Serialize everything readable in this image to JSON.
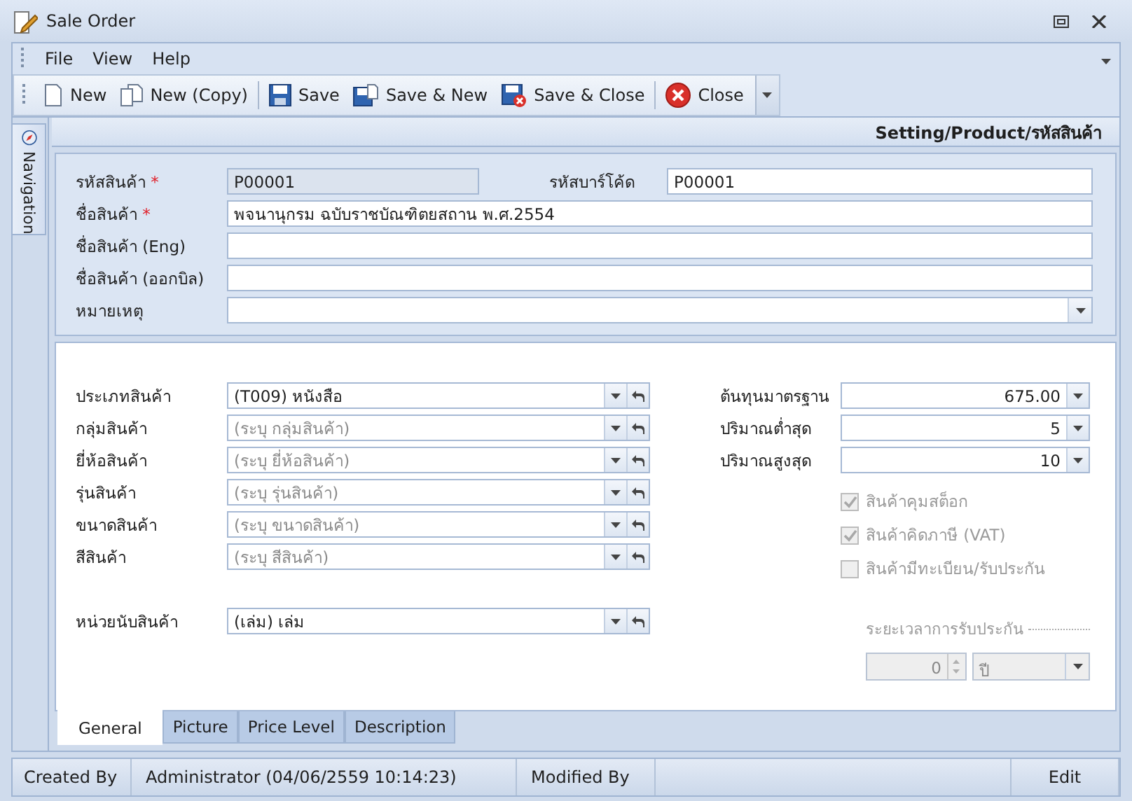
{
  "window": {
    "title": "Sale Order"
  },
  "menu": [
    {
      "label": "File"
    },
    {
      "label": "View"
    },
    {
      "label": "Help"
    }
  ],
  "toolbar": [
    {
      "label": "New",
      "kind": "new"
    },
    {
      "label": "New (Copy)",
      "kind": "copy"
    },
    {
      "label": "Save",
      "kind": "save"
    },
    {
      "label": "Save & New",
      "kind": "save-new"
    },
    {
      "label": "Save & Close",
      "kind": "save-close"
    },
    {
      "label": "Close",
      "kind": "close"
    }
  ],
  "side_tab": {
    "label": "Navigation"
  },
  "breadcrumb": "Setting/Product/รหัสสินค้า",
  "required_mark": "*",
  "code": {
    "label": "รหัสสินค้า",
    "required": true,
    "value": "P00001",
    "disabled": true
  },
  "barcode": {
    "label": "รหัสบาร์โค้ด",
    "value": "P00001"
  },
  "fields": [
    {
      "label": "ชื่อสินค้า",
      "required": true,
      "kind": "text",
      "value": "พจนานุกรม ฉบับราชบัณฑิตยสถาน พ.ศ.2554"
    },
    {
      "label": "ชื่อสินค้า (Eng)",
      "required": false,
      "kind": "text"
    },
    {
      "label": "ชื่อสินค้า (ออกบิล)",
      "required": false,
      "kind": "text"
    },
    {
      "label": "หมายเหตุ",
      "required": false,
      "kind": "combo"
    }
  ],
  "lookups": [
    {
      "label": "ประเภทสินค้า",
      "value": "(T009) หนังสือ"
    },
    {
      "label": "กลุ่มสินค้า",
      "placeholder": "(ระบุ กลุ่มสินค้า)"
    },
    {
      "label": "ยี่ห้อสินค้า",
      "placeholder": "(ระบุ ยี่ห้อสินค้า)"
    },
    {
      "label": "รุ่นสินค้า",
      "placeholder": "(ระบุ รุ่นสินค้า)"
    },
    {
      "label": "ขนาดสินค้า",
      "placeholder": "(ระบุ ขนาดสินค้า)"
    },
    {
      "label": "สีสินค้า",
      "placeholder": "(ระบุ สีสินค้า)"
    }
  ],
  "unit": {
    "label": "หน่วยนับสินค้า",
    "value": "(เล่ม) เล่ม"
  },
  "numbers": [
    {
      "label": "ต้นทุนมาตรฐาน",
      "value": "675.00"
    },
    {
      "label": "ปริมาณต่ำสุด",
      "value": "5"
    },
    {
      "label": "ปริมาณสูงสุด",
      "value": "10"
    }
  ],
  "options": [
    {
      "label": "สินค้าคุมสต็อก",
      "checked": true,
      "disabled": true
    },
    {
      "label": "สินค้าคิดภาษี (VAT)",
      "checked": true,
      "disabled": true
    },
    {
      "label": "สินค้ามีทะเบียน/รับประกัน",
      "checked": false,
      "disabled": true
    }
  ],
  "warranty": {
    "label": "ระยะเวลาการรับประกัน",
    "value": "0",
    "unit": "ปี",
    "disabled": true
  },
  "tabs": [
    {
      "label": "General",
      "selected": true
    },
    {
      "label": "Picture",
      "selected": false
    },
    {
      "label": "Price Level",
      "selected": false
    },
    {
      "label": "Description",
      "selected": false
    }
  ],
  "status_bar": {
    "created_label": "Created By",
    "created_value": "Administrator (04/06/2559 10:14:23)",
    "modified_label": "Modified By",
    "mode": "Edit"
  }
}
